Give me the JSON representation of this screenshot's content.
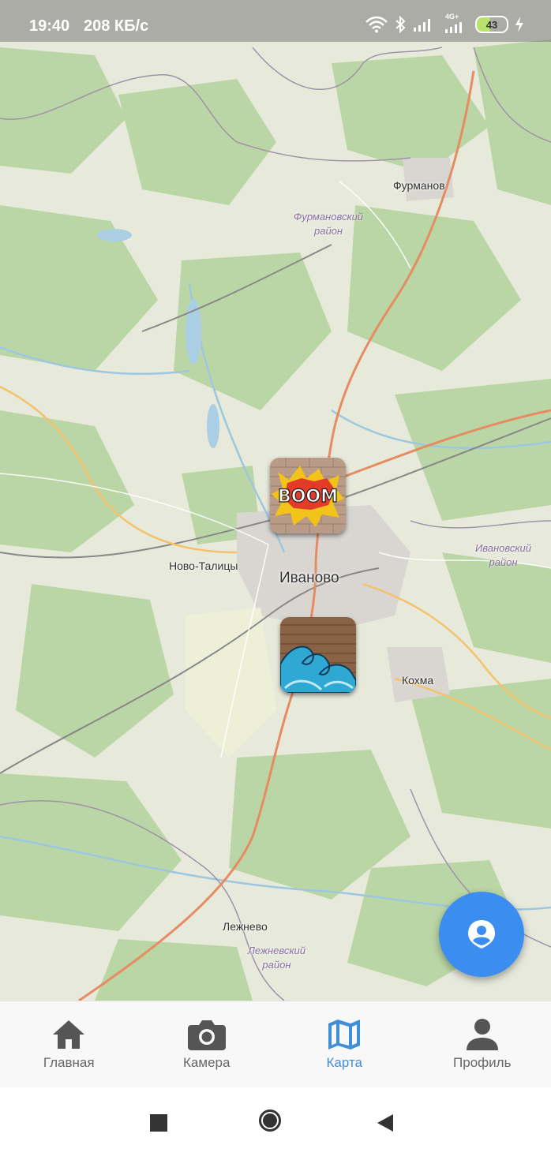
{
  "status_bar": {
    "time": "19:40",
    "speed": "208 КБ/с",
    "network": "4G+",
    "battery": "43"
  },
  "map": {
    "labels": {
      "furmanov": "Фурманов",
      "furmanov_district_1": "Фурмановский",
      "furmanov_district_2": "район",
      "novo_talitsy": "Ново-Талицы",
      "ivanovo": "Иваново",
      "ivanovo_district_1": "Ивановский",
      "ivanovo_district_2": "район",
      "kokhma": "Кохма",
      "lezhnevo": "Лежнево",
      "lezhnevo_district_1": "Лежневский",
      "lezhnevo_district_2": "район"
    },
    "markers": [
      {
        "name": "boom-graffiti",
        "text": "BOOM"
      },
      {
        "name": "wave-graffiti"
      }
    ]
  },
  "bottom_nav": {
    "items": [
      {
        "label": "Главная",
        "icon": "home-icon"
      },
      {
        "label": "Камера",
        "icon": "camera-icon"
      },
      {
        "label": "Карта",
        "icon": "map-icon",
        "active": true
      },
      {
        "label": "Профиль",
        "icon": "person-icon"
      }
    ]
  },
  "colors": {
    "accent": "#3f8fd8",
    "fab": "#3b8ef0",
    "map_green": "#b8d5a3",
    "map_light": "#e7eadb",
    "road": "#e58c62"
  }
}
